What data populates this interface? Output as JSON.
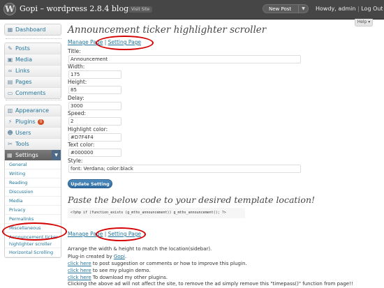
{
  "header": {
    "site_title": "Gopi – wordpress 2.8.4 blog",
    "visit_site": "Visit Site",
    "new_post": "New Post",
    "howdy": "Howdy,",
    "user": "admin",
    "separator": "|",
    "logout": "Log Out",
    "help": "Help"
  },
  "sidebar": {
    "group1": [
      {
        "label": "Dashboard",
        "icon": "dashboard-icon"
      }
    ],
    "group2": [
      {
        "label": "Posts",
        "icon": "posts-icon"
      },
      {
        "label": "Media",
        "icon": "media-icon"
      },
      {
        "label": "Links",
        "icon": "links-icon"
      },
      {
        "label": "Pages",
        "icon": "pages-icon"
      },
      {
        "label": "Comments",
        "icon": "comments-icon"
      }
    ],
    "group3": [
      {
        "label": "Appearance",
        "icon": "appearance-icon"
      },
      {
        "label": "Plugins",
        "icon": "plugins-icon",
        "badge": "0"
      },
      {
        "label": "Users",
        "icon": "users-icon"
      },
      {
        "label": "Tools",
        "icon": "tools-icon"
      }
    ],
    "settings_label": "Settings",
    "settings_sub": [
      "General",
      "Writing",
      "Reading",
      "Discussion",
      "Media",
      "Privacy",
      "Permalinks",
      "Miscellaneous",
      "Announcement ticker highlighter scroller",
      "Horizontal Scrolling"
    ]
  },
  "main": {
    "title": "Announcement ticker highlighter scroller",
    "manage_page": "Manage Page",
    "link_sep": "|",
    "setting_page": "Setting Page",
    "fields": [
      {
        "label": "Title:",
        "value": "Announcement"
      },
      {
        "label": "Width:",
        "value": "175"
      },
      {
        "label": "Height:",
        "value": "85"
      },
      {
        "label": "Delay:",
        "value": "3000"
      },
      {
        "label": "Speed:",
        "value": "2"
      },
      {
        "label": "Highlight color:",
        "value": "#D7F4F4"
      },
      {
        "label": "Text color:",
        "value": "#000000"
      },
      {
        "label": "Style:",
        "value": "font: Verdana; color:black"
      }
    ],
    "update_button": "Update Setting",
    "paste_title": "Paste the below code to your desired template location!",
    "code": "<?php if (function_exists (g_mths_announcement)) g_mths_announcement(); ?>",
    "arrange_text": "Arrange the width & height to match the location(sidebar).",
    "plugin_created_by": "Plug-in created by",
    "author": "Gopi",
    "author_dot": ".",
    "click_here": "click here",
    "post_suggestion": " to post suggestion or comments or how to improve this plugin.",
    "see_demo": " to see my plugin demo.",
    "download_others": " To download my other plugins.",
    "footer_note": "Clicking the above ad will not affect the site, to remove the ad simply remove this \"timepass()\" function from page!!"
  },
  "colors": {
    "header_bg": "#464646",
    "link": "#21759b",
    "highlight_oval": "#d40000",
    "button": "#2e6da4"
  }
}
